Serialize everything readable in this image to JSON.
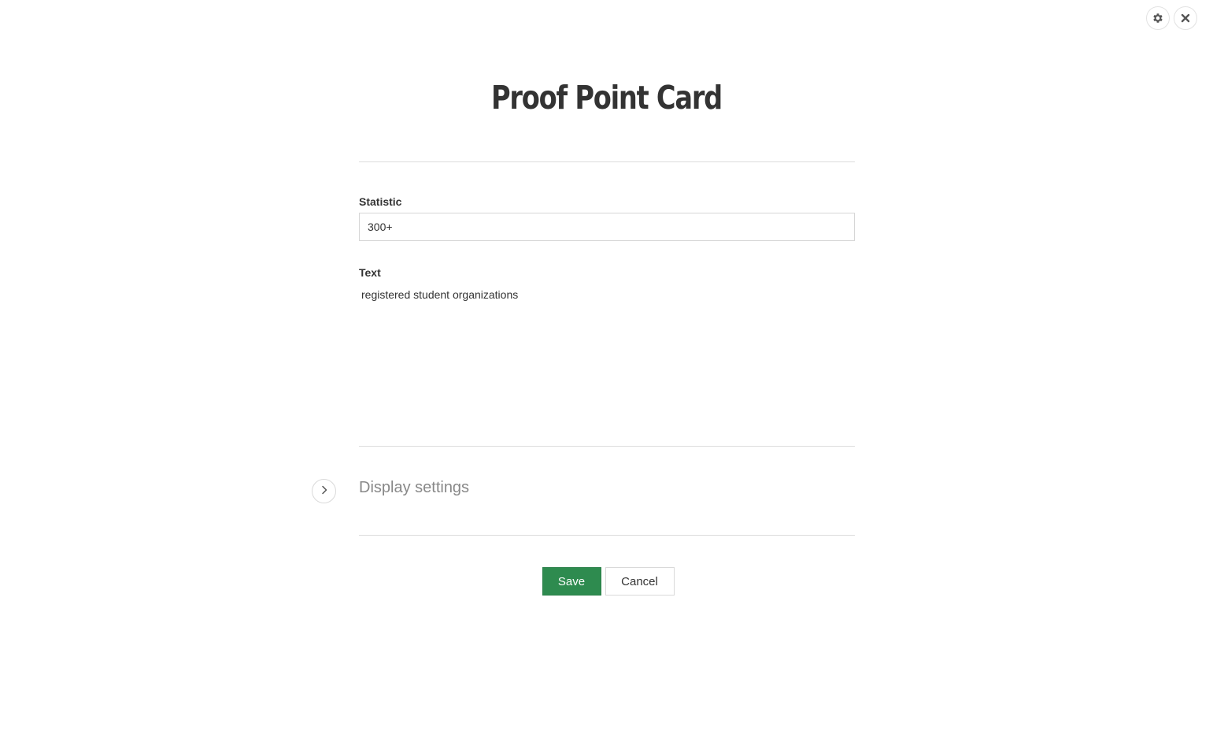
{
  "modal": {
    "title": "Proof Point Card"
  },
  "top_actions": {
    "settings_icon": "gear-icon",
    "close_icon": "close-icon"
  },
  "fields": {
    "statistic": {
      "label": "Statistic",
      "value": "300+"
    },
    "text": {
      "label": "Text",
      "value": "registered student organizations"
    }
  },
  "display_settings": {
    "heading": "Display settings",
    "expand_icon": "chevron-right-icon"
  },
  "buttons": {
    "save_label": "Save",
    "cancel_label": "Cancel"
  },
  "colors": {
    "save_button": "#2e8b4f",
    "text": "#333333",
    "muted_heading": "#888888",
    "divider": "#dcdcdc"
  }
}
